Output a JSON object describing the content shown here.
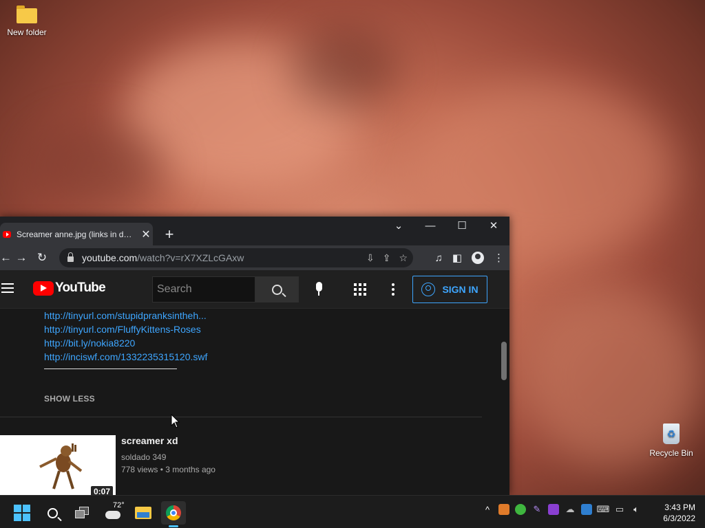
{
  "desktop": {
    "icons": [
      {
        "label": "New folder"
      },
      {
        "label": "Recycle Bin"
      }
    ]
  },
  "browser": {
    "tab": {
      "title": "Screamer anne.jpg (links in descr"
    },
    "url": {
      "host": "youtube.com",
      "path": "/watch?v=rX7XZLcGAxw"
    }
  },
  "youtube": {
    "logo_text": "YouTube",
    "search_placeholder": "Search",
    "sign_in_label": "SIGN IN",
    "description_links": [
      "http://tinyurl.com/stupidpranksintheh...",
      "http://tinyurl.com/FluffyKittens-Roses",
      "http://bit.ly/nokia8220",
      "http://inciswf.com/1332235315120.swf"
    ],
    "show_less_label": "SHOW LESS",
    "recommended": {
      "title": "screamer xd",
      "channel": "soldado 349",
      "views": "778 views",
      "age": "3 months ago",
      "meta_separator": "•",
      "duration": "0:07"
    }
  },
  "taskbar": {
    "weather_temp": "72°",
    "time": "3:43 PM",
    "date": "6/3/2022",
    "accent": "#4cc2ff"
  }
}
